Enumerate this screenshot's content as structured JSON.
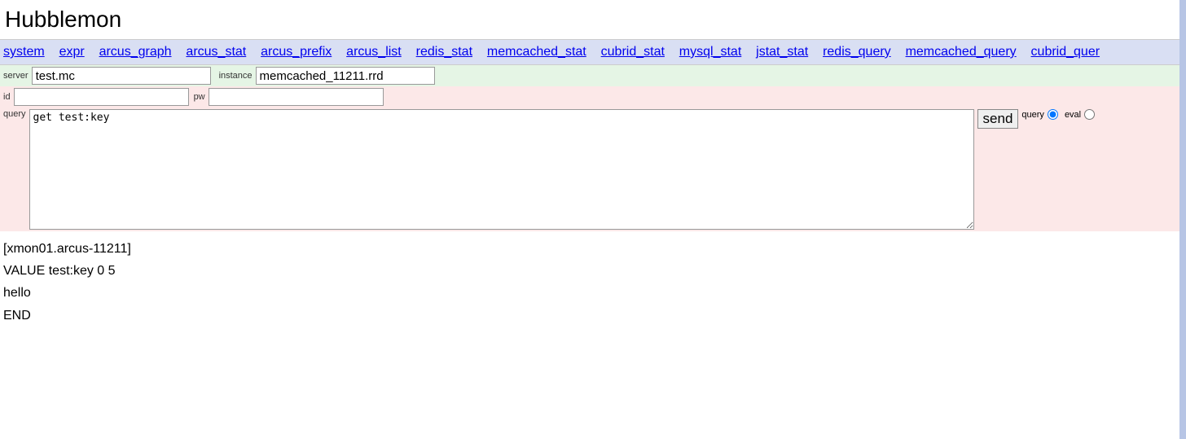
{
  "title": "Hubblemon",
  "nav": {
    "items": [
      "system",
      "expr",
      "arcus_graph",
      "arcus_stat",
      "arcus_prefix",
      "arcus_list",
      "redis_stat",
      "memcached_stat",
      "cubrid_stat",
      "mysql_stat",
      "jstat_stat",
      "redis_query",
      "memcached_query",
      "cubrid_quer"
    ]
  },
  "form": {
    "server_label": "server",
    "server_value": "test.mc",
    "instance_label": "instance",
    "instance_value": "memcached_11211.rrd",
    "id_label": "id",
    "id_value": "",
    "pw_label": "pw",
    "pw_value": "",
    "query_label": "query",
    "query_value": "get test:key",
    "send_label": "send",
    "radio_query_label": "query",
    "radio_eval_label": "eval"
  },
  "result": "[xmon01.arcus-11211]\nVALUE test:key 0 5\nhello\nEND"
}
